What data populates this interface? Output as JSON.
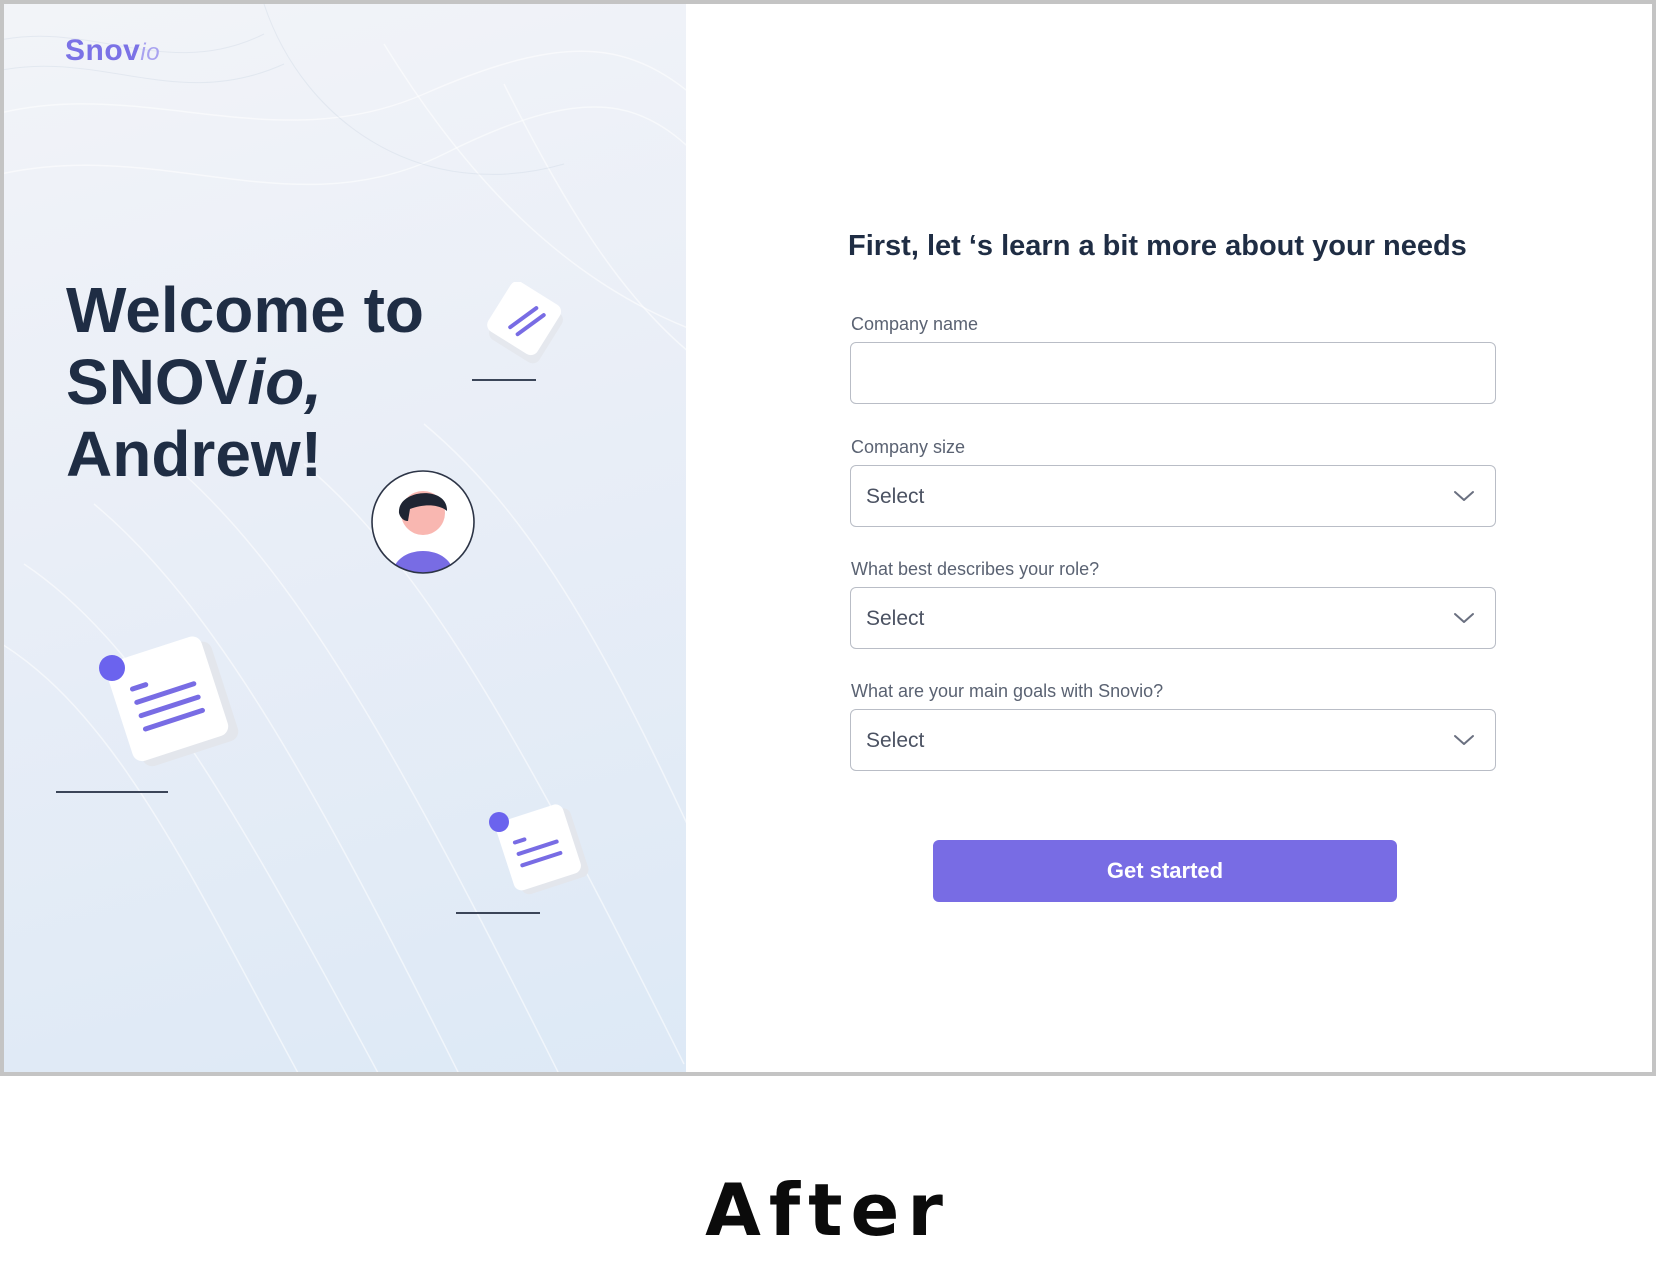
{
  "brand": {
    "logo_main": "Snov",
    "logo_suffix": "io",
    "accent_color": "#786ce4"
  },
  "hero": {
    "line1": "Welcome to",
    "line2_main": "SNOV",
    "line2_italic": "io,",
    "line3": "Andrew!"
  },
  "form": {
    "title": "First, let ‘s learn a bit more about your needs",
    "company_name": {
      "label": "Company name",
      "value": ""
    },
    "company_size": {
      "label": "Company size",
      "value": "Select"
    },
    "role": {
      "label": "What best describes your role?",
      "value": "Select"
    },
    "goals": {
      "label": "What are your main goals with Snovio?",
      "value": "Select"
    },
    "submit_label": "Get started"
  },
  "caption": "After",
  "icons": [
    "note-icon",
    "avatar-icon",
    "chevron-down-icon"
  ]
}
